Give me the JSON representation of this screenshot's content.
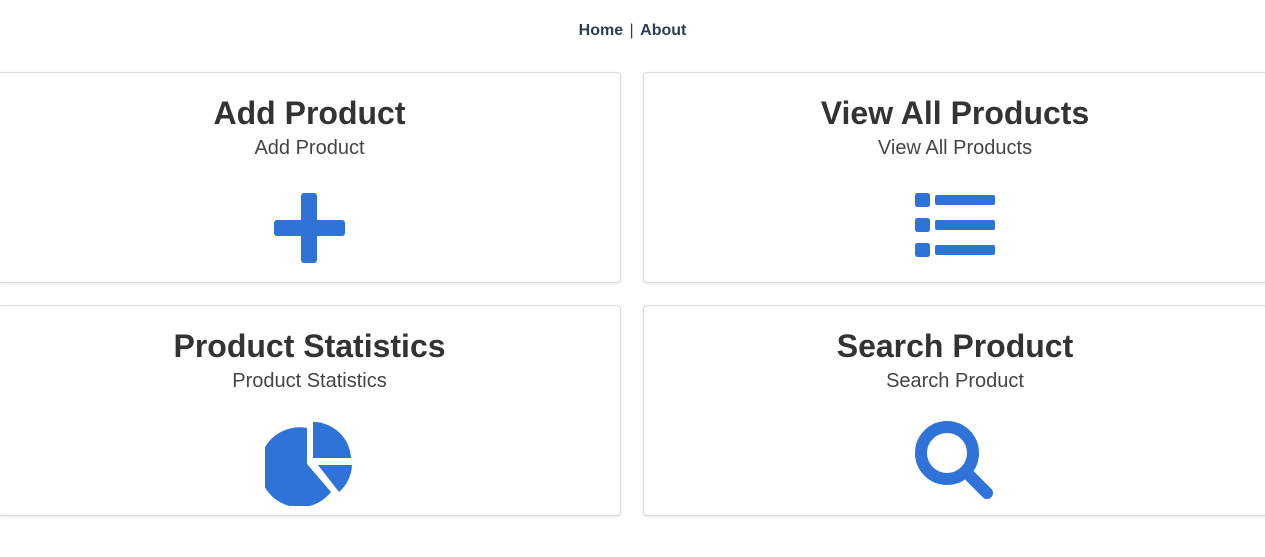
{
  "nav": {
    "home_label": "Home",
    "separator": "|",
    "about_label": "About"
  },
  "colors": {
    "accent": "#2f73d9",
    "text_dark": "#333333",
    "nav_text": "#2c3e50"
  },
  "cards": [
    {
      "title": "Add Product",
      "subtitle": "Add Product",
      "icon": "plus-icon"
    },
    {
      "title": "View All Products",
      "subtitle": "View All Products",
      "icon": "list-icon"
    },
    {
      "title": "Product Statistics",
      "subtitle": "Product Statistics",
      "icon": "pie-chart-icon"
    },
    {
      "title": "Search Product",
      "subtitle": "Search Product",
      "icon": "search-icon"
    }
  ]
}
